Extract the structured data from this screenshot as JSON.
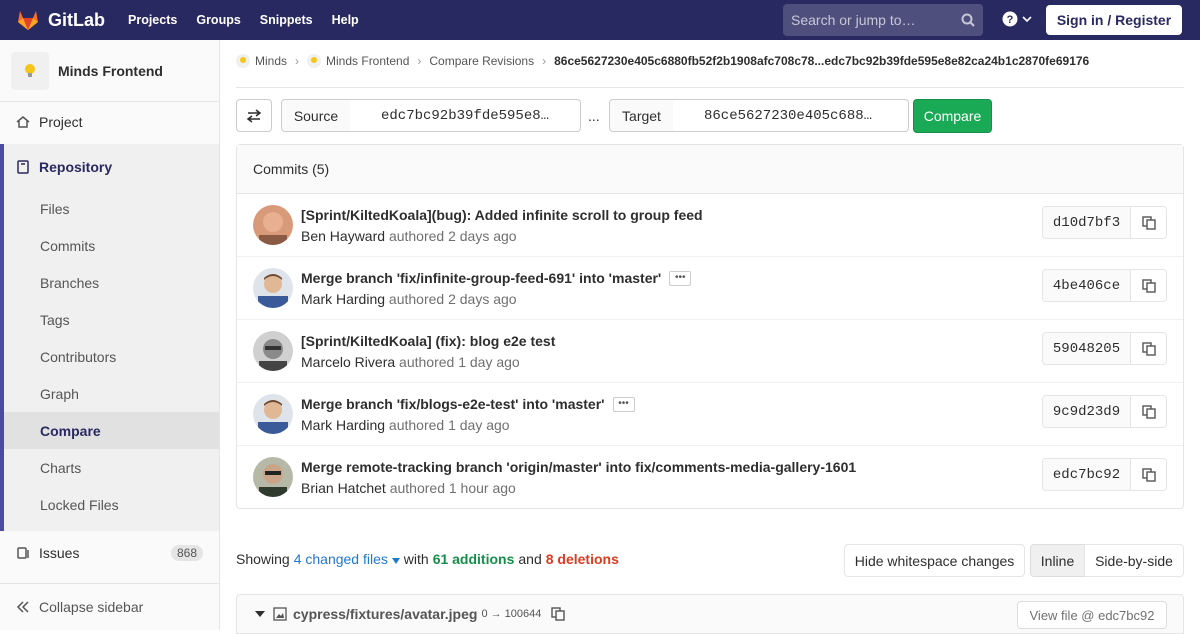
{
  "topbar": {
    "brand": "GitLab",
    "nav": [
      "Projects",
      "Groups",
      "Snippets",
      "Help"
    ],
    "search_placeholder": "Search or jump to…",
    "signin": "Sign in / Register"
  },
  "sidebar": {
    "project_name": "Minds Frontend",
    "project_item": "Project",
    "repository": "Repository",
    "repo_items": [
      "Files",
      "Commits",
      "Branches",
      "Tags",
      "Contributors",
      "Graph",
      "Compare",
      "Charts",
      "Locked Files"
    ],
    "active_item": "Compare",
    "issues": "Issues",
    "issues_count": "868",
    "collapse": "Collapse sidebar"
  },
  "breadcrumb": {
    "items": [
      "Minds",
      "Minds Frontend",
      "Compare Revisions"
    ],
    "current": "86ce5627230e405c6880fb52f2b1908afc708c78...edc7bc92b39fde595e8e82ca24b1c2870fe69176"
  },
  "compare_form": {
    "source_label": "Source",
    "source_value": "edc7bc92b39fde595e8…",
    "separator": "...",
    "target_label": "Target",
    "target_value": "86ce5627230e405c688…",
    "button": "Compare"
  },
  "commits": {
    "header": "Commits (5)",
    "rows": [
      {
        "title": "[Sprint/KiltedKoala](bug): Added infinite scroll to group feed",
        "author": "Ben Hayward",
        "time": "authored 2 days ago",
        "sha": "d10d7bf3",
        "has_more": false
      },
      {
        "title": "Merge branch 'fix/infinite-group-feed-691' into 'master'",
        "author": "Mark Harding",
        "time": "authored 2 days ago",
        "sha": "4be406ce",
        "has_more": true
      },
      {
        "title": "[Sprint/KiltedKoala] (fix): blog e2e test",
        "author": "Marcelo Rivera",
        "time": "authored 1 day ago",
        "sha": "59048205",
        "has_more": false
      },
      {
        "title": "Merge branch 'fix/blogs-e2e-test' into 'master'",
        "author": "Mark Harding",
        "time": "authored 1 day ago",
        "sha": "9c9d23d9",
        "has_more": true
      },
      {
        "title": "Merge remote-tracking branch 'origin/master' into fix/comments-media-gallery-1601",
        "author": "Brian Hatchet",
        "time": "authored 1 hour ago",
        "sha": "edc7bc92",
        "has_more": false
      }
    ]
  },
  "diff_stats": {
    "showing": "Showing",
    "changed": "4 changed files",
    "with": "with",
    "additions": "61 additions",
    "and": "and",
    "deletions": "8 deletions",
    "hide_ws": "Hide whitespace changes",
    "inline": "Inline",
    "side_by_side": "Side-by-side"
  },
  "file": {
    "path": "cypress/fixtures/avatar.jpeg",
    "mode": "0 → 100644",
    "view_file": "View file @ edc7bc92"
  },
  "colors": {
    "topbar": "#292961",
    "accent": "#4b4ba3",
    "compare_btn": "#1aaa55",
    "additions": "#168f48",
    "deletions": "#db3b21",
    "link": "#1f78d1"
  }
}
